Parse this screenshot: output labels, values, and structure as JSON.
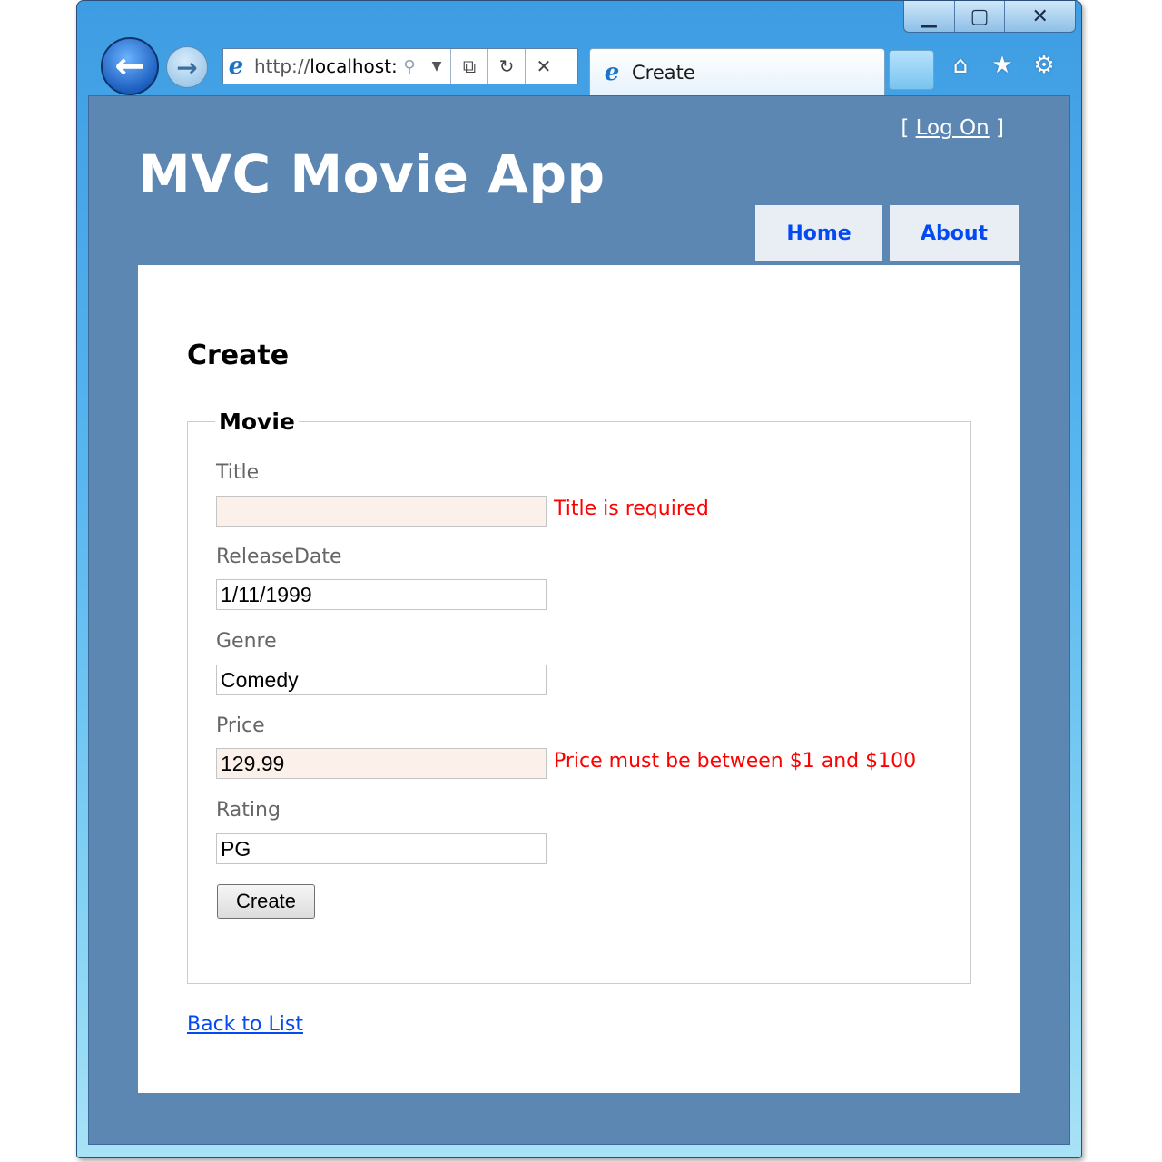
{
  "browser": {
    "url_prefix": "http://",
    "url_host": "localhost:",
    "tab_title": "Create",
    "window_controls": {
      "minimize": "▁",
      "maximize": "▢",
      "close": "✕"
    },
    "icons": [
      "back-icon",
      "forward-icon",
      "ie-logo-icon",
      "search-icon",
      "dropdown-icon",
      "compat-view-icon",
      "refresh-icon",
      "stop-icon",
      "home-icon",
      "favorites-star-icon",
      "settings-gear-icon"
    ]
  },
  "header": {
    "login_prefix": "[",
    "login_link": "Log On",
    "login_suffix": "]",
    "app_title": "MVC Movie App"
  },
  "menu": {
    "home": "Home",
    "about": "About"
  },
  "main": {
    "heading": "Create",
    "legend": "Movie",
    "fields": {
      "title": {
        "label": "Title",
        "value": "",
        "error": "Title is required"
      },
      "release_date": {
        "label": "ReleaseDate",
        "value": "1/11/1999"
      },
      "genre": {
        "label": "Genre",
        "value": "Comedy"
      },
      "price": {
        "label": "Price",
        "value": "129.99",
        "error": "Price must be between $1 and $100"
      },
      "rating": {
        "label": "Rating",
        "value": "PG"
      }
    },
    "submit_label": "Create",
    "back_link": "Back to List"
  },
  "colors": {
    "page_background": "#5c87b2",
    "menu_link": "#034af3",
    "error_text": "#ff0000",
    "error_input_background": "#fbf0ea"
  }
}
